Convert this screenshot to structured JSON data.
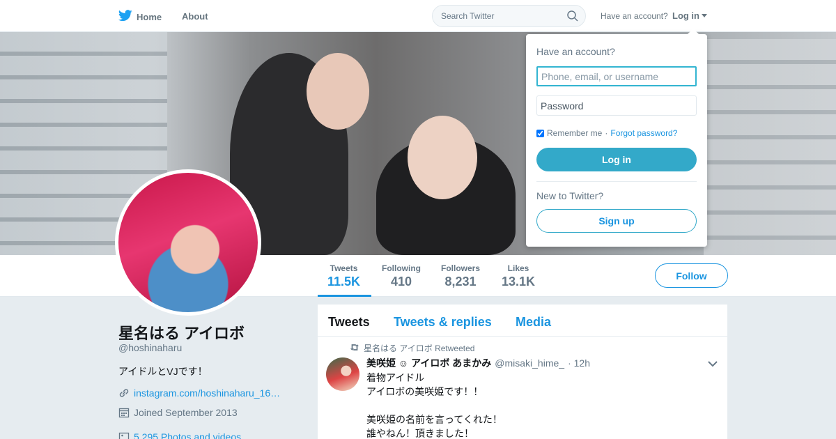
{
  "nav": {
    "home_label": "Home",
    "about_label": "About",
    "search_placeholder": "Search Twitter",
    "have_account": "Have an account?",
    "login_label": "Log in",
    "brand_color": "#1da1f2"
  },
  "profile": {
    "fullname": "星名はる アイロボ",
    "screen_name": "@hoshinaharu",
    "bio": "アイドルとVJです！",
    "url": "instagram.com/hoshinaharu_16…",
    "joined": "Joined September 2013",
    "photos_videos": "5,295 Photos and videos",
    "follow_label": "Follow"
  },
  "stats": [
    {
      "label": "Tweets",
      "value": "11.5K"
    },
    {
      "label": "Following",
      "value": "410"
    },
    {
      "label": "Followers",
      "value": "8,231"
    },
    {
      "label": "Likes",
      "value": "13.1K"
    }
  ],
  "timeline": {
    "tabs": [
      "Tweets",
      "Tweets & replies",
      "Media"
    ],
    "tweet": {
      "retweet_context": "星名はる アイロボ Retweeted",
      "name": "美咲姫 ☺ アイロボ あまかみ",
      "handle": "@misaki_hime_",
      "time": "· 12h",
      "text": "着物アイドル\nアイロボの美咲姫です！！\n\n美咲姫の名前を言ってくれた！\n誰やねん！頂きました！"
    }
  },
  "login_dropdown": {
    "title": "Have an account?",
    "username_placeholder": "Phone, email, or username",
    "password_placeholder": "Password",
    "remember_label": "Remember me",
    "separator": "·",
    "forgot_label": "Forgot password?",
    "login_button": "Log in",
    "new_label": "New to Twitter?",
    "signup_button": "Sign up"
  }
}
